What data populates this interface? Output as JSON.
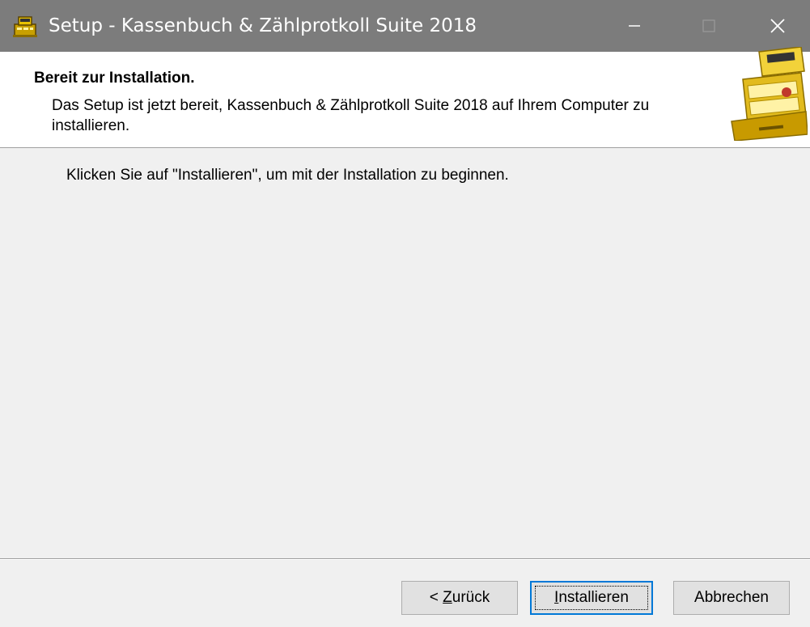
{
  "window": {
    "title": "Setup - Kassenbuch & Zählprotkoll Suite 2018",
    "icon": "cash-register-icon",
    "controls": {
      "minimize": "minimize-icon",
      "maximize": "maximize-icon",
      "close": "close-icon"
    }
  },
  "header": {
    "title": "Bereit zur Installation.",
    "subtitle": "Das Setup ist jetzt bereit, Kassenbuch & Zählprotkoll Suite 2018 auf Ihrem Computer zu installieren.",
    "logo": "cash-register-icon"
  },
  "main": {
    "instruction": "Klicken Sie auf \"Installieren\", um mit der Installation zu beginnen."
  },
  "buttons": {
    "back_prefix": "< ",
    "back_accel": "Z",
    "back_rest": "urück",
    "install_accel": "I",
    "install_rest": "nstallieren",
    "cancel": "Abbrechen"
  },
  "colors": {
    "titlebar": "#7c7c7c",
    "focus_border": "#0078d7",
    "dialog_bg": "#f0f0f0"
  }
}
